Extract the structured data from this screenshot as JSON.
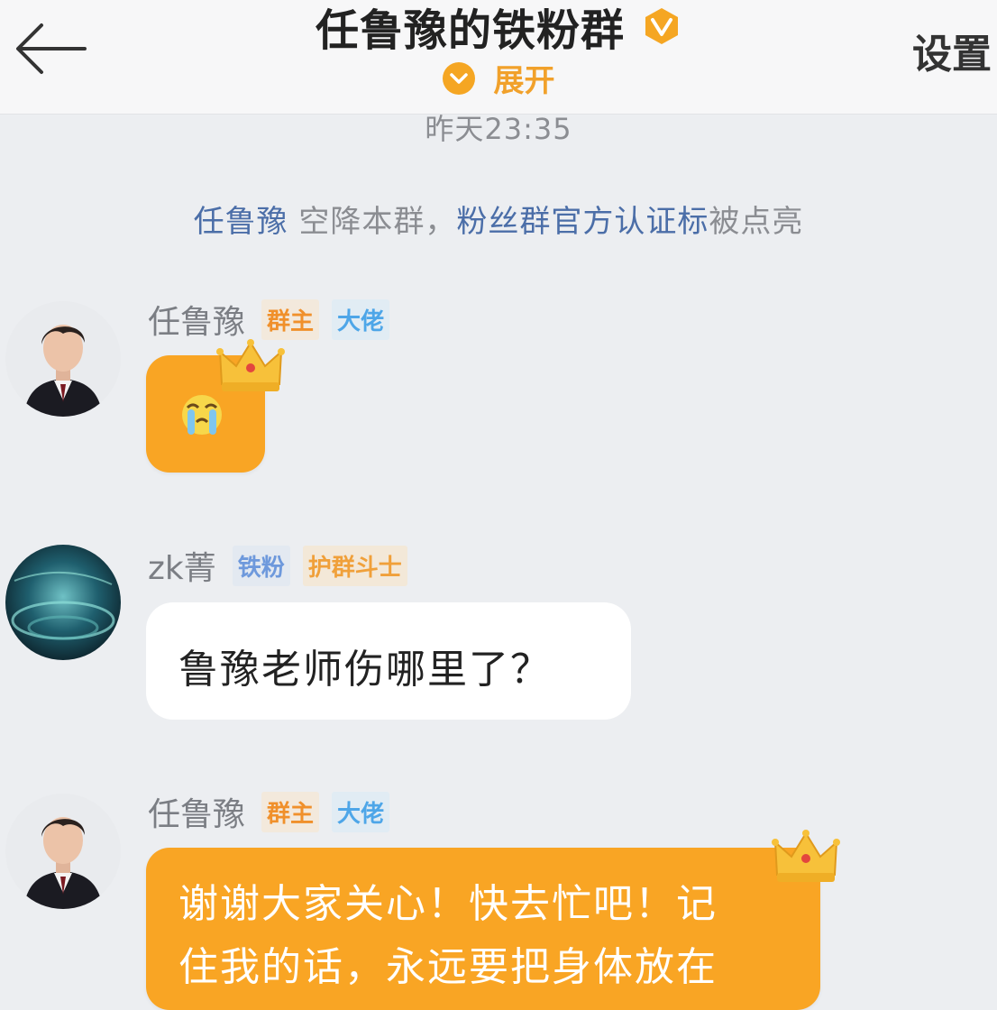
{
  "header": {
    "title": "任鲁豫的铁粉群",
    "expand_label": "展开",
    "settings_label": "设置",
    "accent": "#f1a12b"
  },
  "timestamp": "昨天23:35",
  "notice": {
    "user": "任鲁豫",
    "middle": " 空降本群，",
    "badge": "粉丝群官方认证标",
    "tail": "被点亮"
  },
  "messages": [
    {
      "sender": "任鲁豫",
      "tags": [
        "群主",
        "大佬"
      ],
      "content_type": "emoji",
      "emoji": "crying-face"
    },
    {
      "sender": "zk菁",
      "tags": [
        "铁粉",
        "护群斗士"
      ],
      "content_type": "text",
      "text": "鲁豫老师伤哪里了？"
    },
    {
      "sender": "任鲁豫",
      "tags": [
        "群主",
        "大佬"
      ],
      "content_type": "text",
      "lines": [
        "谢谢大家关心！快去忙吧！记",
        "住我的话，永远要把身体放在"
      ]
    }
  ],
  "colors": {
    "owner_bubble": "#f9a524",
    "link_blue": "#4b6ea8",
    "background": "#eceef1"
  }
}
